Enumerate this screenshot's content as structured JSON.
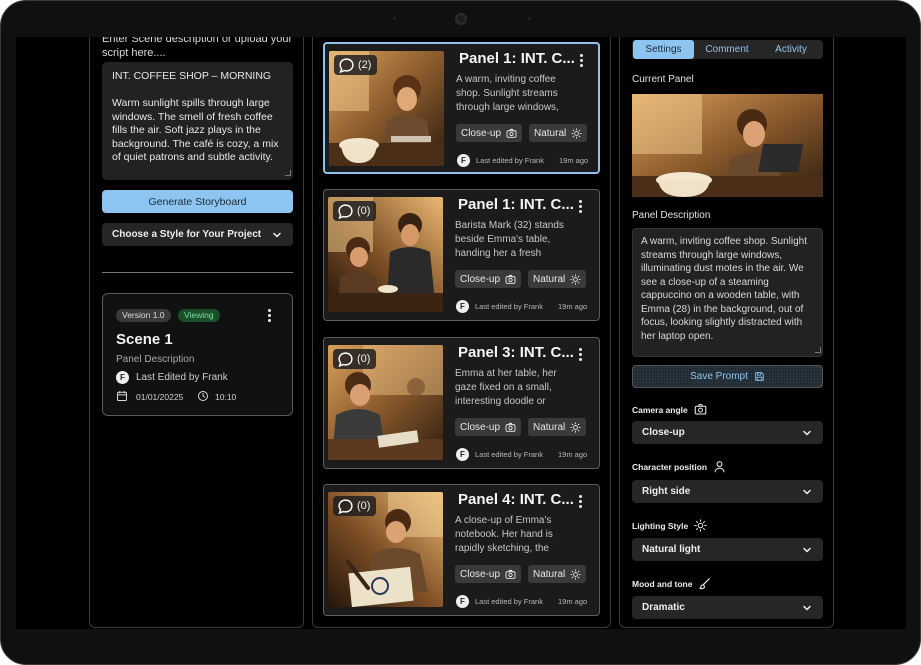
{
  "left": {
    "intro": "Enter Scene description or upload your script here....",
    "script": "INT. COFFEE SHOP – MORNING\n\nWarm sunlight spills through large windows. The smell of fresh coffee fills the air. Soft jazz plays in the background. The café is cozy, a mix of quiet patrons and subtle activity.",
    "generate_label": "Generate Storyboard",
    "style_label": "Choose a Style for Your Project",
    "scene_card": {
      "version": "Version 1.0",
      "status": "Viewing",
      "title": "Scene 1",
      "description": "Panel Description",
      "avatar_initial": "F",
      "edited": "Last Edited by Frank",
      "date": "01/01/20225",
      "time": "10:10"
    }
  },
  "panels": [
    {
      "comments": "(2)",
      "title": "Panel 1: INT. C...",
      "text": "A warm, inviting coffee shop. Sunlight streams through large windows,",
      "shot": "Close-up",
      "light": "Natural",
      "avatar": "F",
      "edited": "Last edited by Frank",
      "time": "19m ago"
    },
    {
      "comments": "(0)",
      "title": "Panel 1: INT. C...",
      "text": " Barista Mark (32) stands beside Emma's table, handing her a fresh",
      "shot": "Close-up",
      "light": "Natural",
      "avatar": "F",
      "edited": "Last edited by Frank",
      "time": "19m ago"
    },
    {
      "comments": "(0)",
      "title": "Panel 3: INT. C...",
      "text": "Emma at her table, her gaze fixed on a small, interesting doodle or sketch on a",
      "shot": "Close-up",
      "light": "Natural",
      "avatar": "F",
      "edited": "Last edited by Frank",
      "time": "19m ago"
    },
    {
      "comments": "(0)",
      "title": "Panel 4: INT. C...",
      "text": " A close-up of Emma's notebook. Her hand is rapidly sketching, the page",
      "shot": "Close-up",
      "light": "Natural",
      "avatar": "F",
      "edited": "Last edited by Frank",
      "time": "19m ago"
    }
  ],
  "right": {
    "tabs": [
      "Settings",
      "Comment",
      "Activity"
    ],
    "active_tab": "Settings",
    "current_panel_label": "Current Panel",
    "panel_desc_label": "Panel Description",
    "panel_desc": "A warm, inviting coffee shop. Sunlight streams through large windows, illuminating dust motes in the air. We see a close-up of a steaming cappuccino on a wooden table, with Emma (28) in the background, out of focus, looking slightly distracted with her laptop open.",
    "save_label": "Save Prompt",
    "camera_label": "Camera angle",
    "camera_value": "Close-up",
    "position_label": "Character position",
    "position_value": "Right side",
    "lighting_label": "Lighting Style",
    "lighting_value": "Natural light",
    "mood_label": "Mood and tone",
    "mood_value": "Dramatic"
  },
  "colors": {
    "accent": "#8ec5f0",
    "viewing_badge": "#1b4f2b",
    "panel_bg": "#1b1b1b"
  }
}
